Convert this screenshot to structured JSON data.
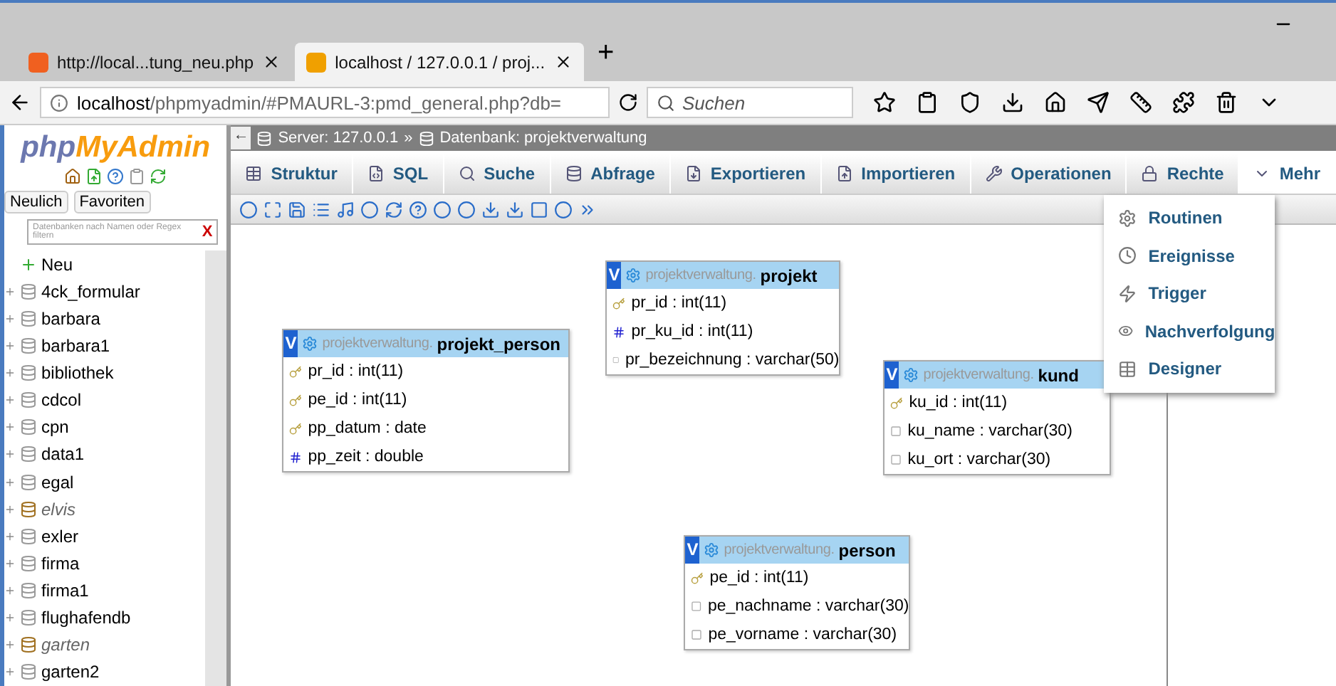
{
  "browser": {
    "tabs": [
      {
        "label": "http://local...tung_neu.php",
        "selected": false
      },
      {
        "label": "localhost / 127.0.0.1 / proj...",
        "selected": true
      }
    ],
    "new_tab": "+",
    "url": {
      "host": "localhost",
      "path": "/phpmyadmin/#PMAURL-3:pmd_general.php?db="
    },
    "search": {
      "placeholder": "Suchen"
    }
  },
  "sidebar": {
    "logo": {
      "part_1": "php",
      "part_2": "MyAdmin"
    },
    "tabs": [
      {
        "label": "Neulich"
      },
      {
        "label": "Favoriten"
      }
    ],
    "filter": {
      "placeholder": "Datenbanken nach Namen oder Regex filtern",
      "clear": "X"
    },
    "databases": [
      {
        "name": "Neu",
        "kind": "new"
      },
      {
        "name": "4ck_formular",
        "kind": "database"
      },
      {
        "name": "barbara",
        "kind": "database"
      },
      {
        "name": "barbara1",
        "kind": "database"
      },
      {
        "name": "bibliothek",
        "kind": "database"
      },
      {
        "name": "cdcol",
        "kind": "database"
      },
      {
        "name": "cpn",
        "kind": "database"
      },
      {
        "name": "data1",
        "kind": "database"
      },
      {
        "name": "egal",
        "kind": "database"
      },
      {
        "name": "elvis",
        "kind": "special"
      },
      {
        "name": "exler",
        "kind": "database"
      },
      {
        "name": "firma",
        "kind": "database"
      },
      {
        "name": "firma1",
        "kind": "database"
      },
      {
        "name": "flughafendb",
        "kind": "database"
      },
      {
        "name": "garten",
        "kind": "special"
      },
      {
        "name": "garten2",
        "kind": "database"
      }
    ]
  },
  "breadcrumb": {
    "back": "←",
    "server": "Server: 127.0.0.1",
    "separator": "»",
    "database": "Datenbank: projektverwaltung"
  },
  "nav_tabs": [
    {
      "label": "Struktur",
      "selected": false
    },
    {
      "label": "SQL",
      "selected": false
    },
    {
      "label": "Suche",
      "selected": false
    },
    {
      "label": "Abfrage",
      "selected": false
    },
    {
      "label": "Exportieren",
      "selected": false
    },
    {
      "label": "Importieren",
      "selected": false
    },
    {
      "label": "Operationen",
      "selected": false
    },
    {
      "label": "Rechte",
      "selected": false
    },
    {
      "label": "Mehr",
      "selected": true
    }
  ],
  "more_menu": [
    {
      "label": "Routinen"
    },
    {
      "label": "Ereignisse"
    },
    {
      "label": "Trigger"
    },
    {
      "label": "Nachverfolgung"
    },
    {
      "label": "Designer"
    }
  ],
  "designer_tables": [
    {
      "toggle": "V",
      "schema": "projektverwaltung.",
      "name": "projekt_person",
      "fields": [
        {
          "text": "pr_id : int(11)",
          "kind": "primary"
        },
        {
          "text": "pe_id : int(11)",
          "kind": "primary"
        },
        {
          "text": "pp_datum : date",
          "kind": "primary"
        },
        {
          "text": "pp_zeit : double",
          "kind": "number"
        }
      ]
    },
    {
      "toggle": "V",
      "schema": "projektverwaltung.",
      "name": "projekt",
      "fields": [
        {
          "text": "pr_id : int(11)",
          "kind": "primary"
        },
        {
          "text": "pr_ku_id : int(11)",
          "kind": "number"
        },
        {
          "text": "pr_bezeichnung : varchar(50)",
          "kind": "text"
        }
      ]
    },
    {
      "toggle": "V",
      "schema": "projektverwaltung.",
      "name": "kund",
      "fields": [
        {
          "text": "ku_id : int(11)",
          "kind": "primary"
        },
        {
          "text": "ku_name : varchar(30)",
          "kind": "text"
        },
        {
          "text": "ku_ort : varchar(30)",
          "kind": "text"
        }
      ]
    },
    {
      "toggle": "V",
      "schema": "projektverwaltung.",
      "name": "person",
      "fields": [
        {
          "text": "pe_id : int(11)",
          "kind": "primary"
        },
        {
          "text": "pe_nachname : varchar(30)",
          "kind": "text"
        },
        {
          "text": "pe_vorname : varchar(30)",
          "kind": "text"
        }
      ]
    }
  ]
}
